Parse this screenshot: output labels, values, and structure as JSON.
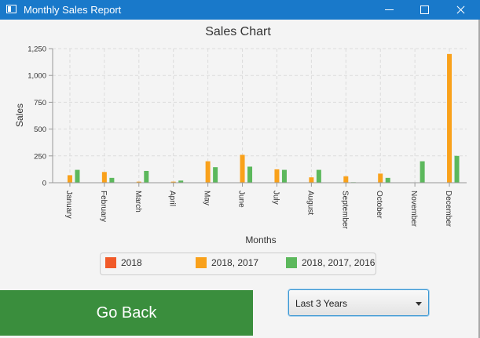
{
  "window": {
    "title": "Monthly Sales Report"
  },
  "controls": {
    "go_back_label": "Go Back",
    "period_selected": "Last 3 Years"
  },
  "chart_data": {
    "type": "bar",
    "title": "Sales Chart",
    "xlabel": "Months",
    "ylabel": "Sales",
    "ylim": [
      0,
      1250
    ],
    "yticks": [
      "0",
      "250",
      "500",
      "750",
      "1,000",
      "1,250"
    ],
    "grid": true,
    "legend_position": "bottom",
    "categories": [
      "January",
      "February",
      "March",
      "April",
      "May",
      "June",
      "July",
      "August",
      "September",
      "October",
      "November",
      "December"
    ],
    "series": [
      {
        "name": "2018",
        "color": "#f15a29",
        "values": [
          0,
          0,
          0,
          0,
          0,
          0,
          0,
          0,
          0,
          0,
          0,
          0
        ]
      },
      {
        "name": "2018, 2017",
        "color": "#f9a11b",
        "values": [
          70,
          100,
          10,
          10,
          200,
          260,
          125,
          50,
          60,
          85,
          0,
          1200
        ]
      },
      {
        "name": "2018, 2017, 2016",
        "color": "#5cb85c",
        "values": [
          120,
          45,
          110,
          20,
          145,
          150,
          120,
          120,
          5,
          45,
          200,
          250
        ]
      }
    ]
  }
}
